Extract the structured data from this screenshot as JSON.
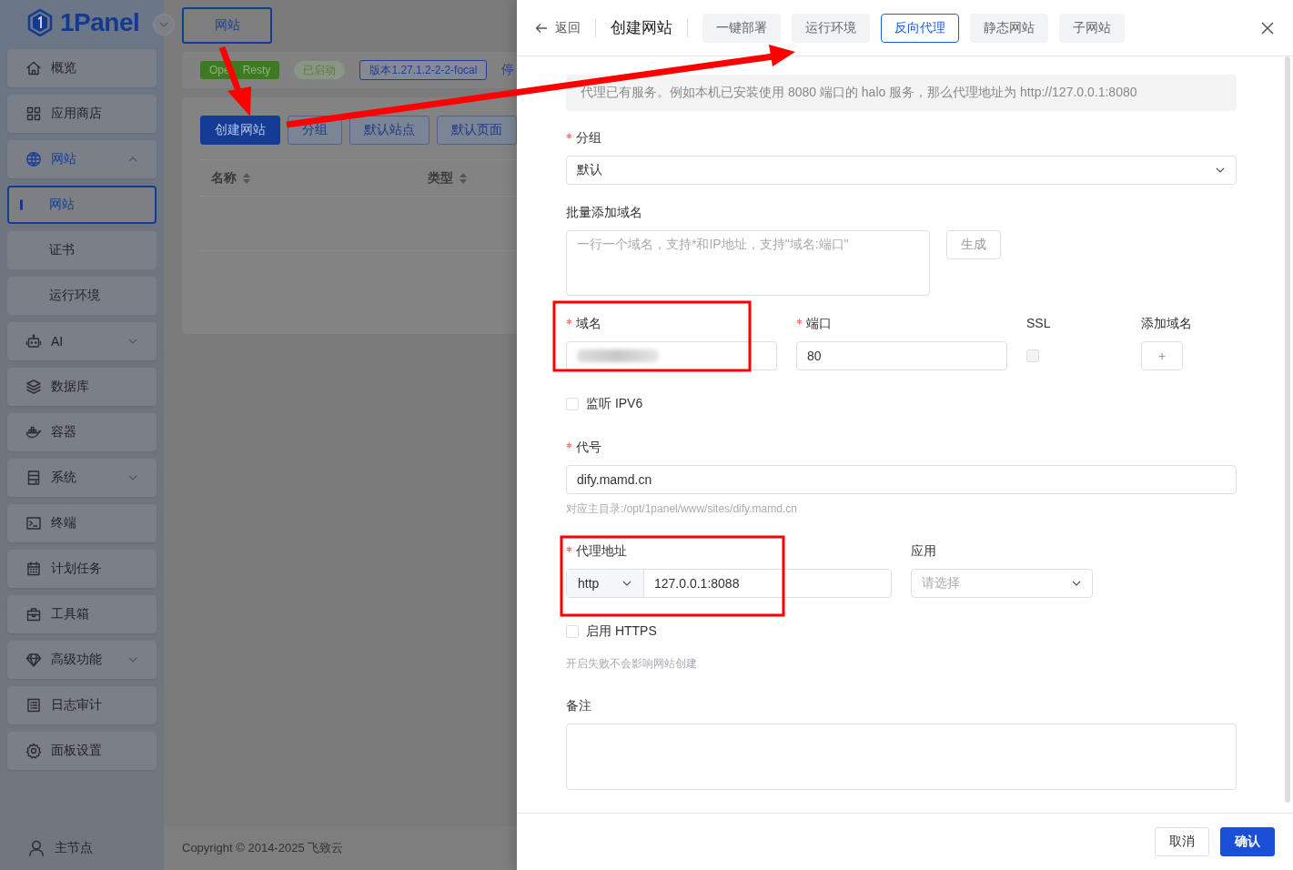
{
  "sidebar": {
    "logo": "1Panel",
    "items": [
      {
        "label": "概览",
        "selected": false
      },
      {
        "label": "应用商店",
        "selected": false
      },
      {
        "label": "网站",
        "selected": true,
        "expanded": true,
        "children": [
          {
            "label": "网站",
            "selected": true
          },
          {
            "label": "证书",
            "selected": false
          },
          {
            "label": "运行环境",
            "selected": false
          }
        ]
      },
      {
        "label": "AI",
        "selected": false,
        "expanded": false
      },
      {
        "label": "数据库",
        "selected": false
      },
      {
        "label": "容器",
        "selected": false
      },
      {
        "label": "系统",
        "selected": false,
        "expanded": false
      },
      {
        "label": "终端",
        "selected": false
      },
      {
        "label": "计划任务",
        "selected": false
      },
      {
        "label": "工具箱",
        "selected": false
      },
      {
        "label": "高级功能",
        "selected": false,
        "expanded": false
      },
      {
        "label": "日志审计",
        "selected": false
      },
      {
        "label": "面板设置",
        "selected": false
      }
    ],
    "node": "主节点"
  },
  "page_tab": "网站",
  "status_bar": {
    "tags": [
      {
        "kind": "app",
        "parts": [
          "Ope",
          "Resty"
        ]
      },
      {
        "kind": "status",
        "text": "已启动"
      },
      {
        "kind": "version",
        "text": "版本1.27.1.2-2-2-focal"
      }
    ],
    "link": "停"
  },
  "toolbar": [
    {
      "label": "创建网站",
      "primary": true
    },
    {
      "label": "分组",
      "primary": false
    },
    {
      "label": "默认站点",
      "primary": false
    },
    {
      "label": "默认页面",
      "primary": false
    }
  ],
  "table": {
    "columns": [
      "名称",
      "类型"
    ]
  },
  "copyright": "Copyright © 2014-2025 飞致云",
  "drawer": {
    "back": "返回",
    "title": "创建网站",
    "tabs": [
      {
        "label": "一键部署",
        "selected": false
      },
      {
        "label": "运行环境",
        "selected": false
      },
      {
        "label": "反向代理",
        "selected": true
      },
      {
        "label": "静态网站",
        "selected": false
      },
      {
        "label": "子网站",
        "selected": false
      }
    ],
    "alert": "代理已有服务。例如本机已安装使用 8080 端口的 halo 服务，那么代理地址为 http://127.0.0.1:8080",
    "group": {
      "label": "分组",
      "required": true,
      "value": "默认"
    },
    "batch": {
      "label": "批量添加域名",
      "placeholder": "一行一个域名，支持*和IP地址，支持\"域名:端口\"",
      "button": "生成"
    },
    "domain": {
      "label": "域名",
      "required": true,
      "value_redacted": true
    },
    "port": {
      "label": "端口",
      "required": true,
      "value": "80"
    },
    "ssl": {
      "label": "SSL",
      "checked": false,
      "disabled": true
    },
    "add_domain": {
      "label": "添加域名",
      "button": "+"
    },
    "ipv6": {
      "label": "监听 IPV6",
      "checked": false
    },
    "alias": {
      "label": "代号",
      "required": true,
      "value": "dify.mamd.cn",
      "hint": "对应主目录:/opt/1panel/www/sites/dify.mamd.cn"
    },
    "proxy": {
      "label": "代理地址",
      "required": true,
      "protocol": "http",
      "value": "127.0.0.1:8088"
    },
    "app": {
      "label": "应用",
      "placeholder": "请选择"
    },
    "https": {
      "label": "启用 HTTPS",
      "checked": false,
      "hint": "开启失败不会影响网站创建"
    },
    "remark": {
      "label": "备注"
    },
    "buttons": [
      {
        "label": "取消",
        "primary": false
      },
      {
        "label": "确认",
        "primary": true
      }
    ]
  }
}
